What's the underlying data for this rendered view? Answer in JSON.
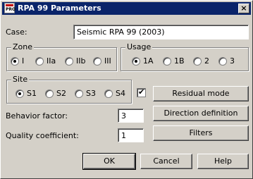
{
  "window": {
    "title": "RPA 99 Parameters",
    "icon_text": "PRO",
    "close_glyph": "×"
  },
  "case": {
    "label": "Case:",
    "value": "Seismic RPA 99 (2003)"
  },
  "zone": {
    "label": "Zone",
    "options": [
      {
        "label": "I",
        "selected": true
      },
      {
        "label": "IIa",
        "selected": false
      },
      {
        "label": "IIb",
        "selected": false
      },
      {
        "label": "III",
        "selected": false
      }
    ]
  },
  "usage": {
    "label": "Usage",
    "options": [
      {
        "label": "1A",
        "selected": true
      },
      {
        "label": "1B",
        "selected": false
      },
      {
        "label": "2",
        "selected": false
      },
      {
        "label": "3",
        "selected": false
      }
    ]
  },
  "site": {
    "label": "Site",
    "options": [
      {
        "label": "S1",
        "selected": true
      },
      {
        "label": "S2",
        "selected": false
      },
      {
        "label": "S3",
        "selected": false
      },
      {
        "label": "S4",
        "selected": false
      }
    ]
  },
  "residual": {
    "checked": true,
    "check_glyph": "✔",
    "button_label": "Residual mode"
  },
  "behavior_factor": {
    "label": "Behavior factor:",
    "value": "3"
  },
  "quality_coefficient": {
    "label": "Quality coefficient:",
    "value": "1"
  },
  "buttons": {
    "direction_definition": "Direction definition",
    "filters": "Filters",
    "ok": "OK",
    "cancel": "Cancel",
    "help": "Help"
  }
}
